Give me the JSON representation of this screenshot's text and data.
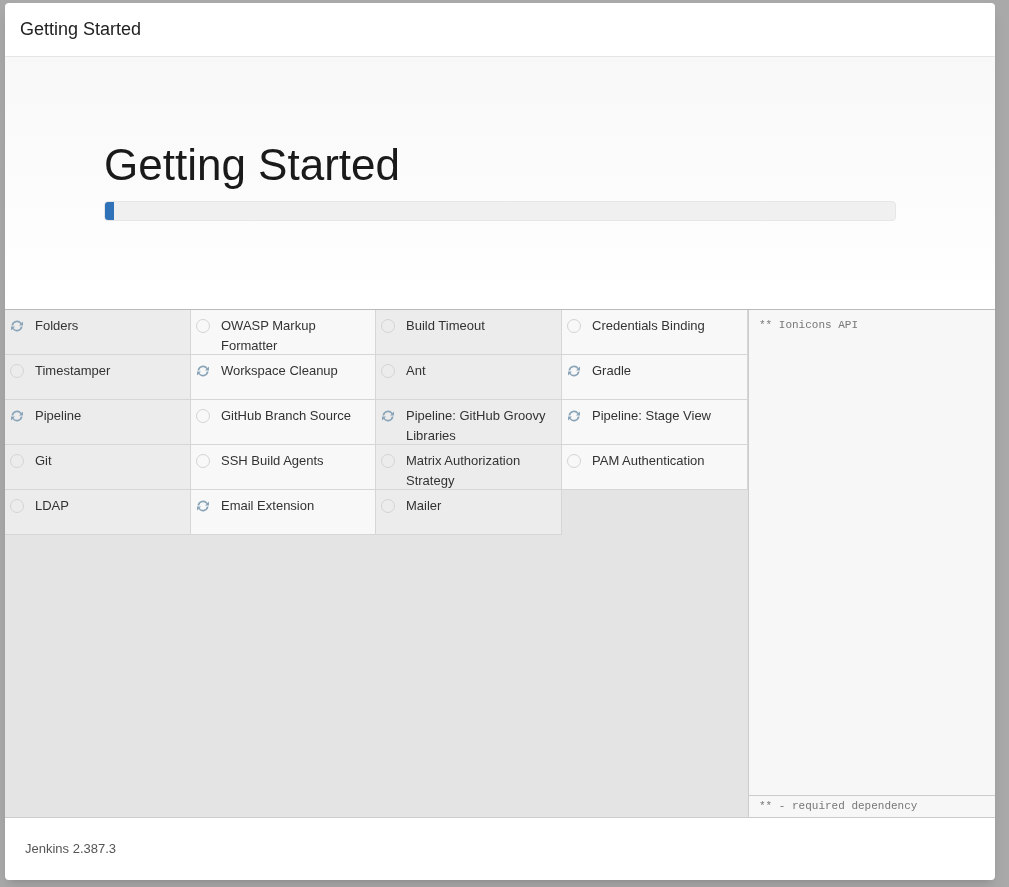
{
  "window": {
    "title": "Getting Started"
  },
  "hero": {
    "heading": "Getting Started",
    "progress": {
      "level": 0.012
    }
  },
  "plugins": [
    {
      "name": "Folders",
      "kind": "installing"
    },
    {
      "name": "OWASP Markup Formatter",
      "kind": "pending"
    },
    {
      "name": "Build Timeout",
      "kind": "pending"
    },
    {
      "name": "Credentials Binding",
      "kind": "pending"
    },
    {
      "name": "Timestamper",
      "kind": "pending"
    },
    {
      "name": "Workspace Cleanup",
      "kind": "installing"
    },
    {
      "name": "Ant",
      "kind": "pending"
    },
    {
      "name": "Gradle",
      "kind": "installing"
    },
    {
      "name": "Pipeline",
      "kind": "installing"
    },
    {
      "name": "GitHub Branch Source",
      "kind": "pending"
    },
    {
      "name": "Pipeline: GitHub Groovy Libraries",
      "kind": "installing"
    },
    {
      "name": "Pipeline: Stage View",
      "kind": "installing"
    },
    {
      "name": "Git",
      "kind": "pending"
    },
    {
      "name": "SSH Build Agents",
      "kind": "pending"
    },
    {
      "name": "Matrix Authorization Strategy",
      "kind": "pending"
    },
    {
      "name": "PAM Authentication",
      "kind": "pending"
    },
    {
      "name": "LDAP",
      "kind": "pending"
    },
    {
      "name": "Email Extension",
      "kind": "installing"
    },
    {
      "name": "Mailer",
      "kind": "pending"
    }
  ],
  "log": {
    "lines": [
      "** Ionicons API"
    ],
    "legend": "** - required dependency"
  },
  "footer": {
    "version": "Jenkins 2.387.3"
  }
}
